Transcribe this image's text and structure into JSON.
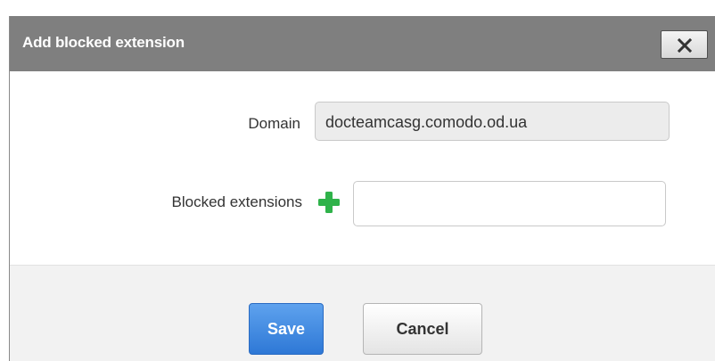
{
  "dialog": {
    "title": "Add blocked extension",
    "close_icon": "close-icon"
  },
  "form": {
    "domain_label": "Domain",
    "domain_value": "docteamcasg.comodo.od.ua",
    "blocked_extensions_label": "Blocked extensions",
    "blocked_extensions_value": "",
    "add_icon": "plus-icon"
  },
  "footer": {
    "save_label": "Save",
    "cancel_label": "Cancel"
  },
  "colors": {
    "titlebar": "#7f7f7f",
    "save_button": "#2e78d6",
    "plus_icon": "#2fb24a"
  }
}
